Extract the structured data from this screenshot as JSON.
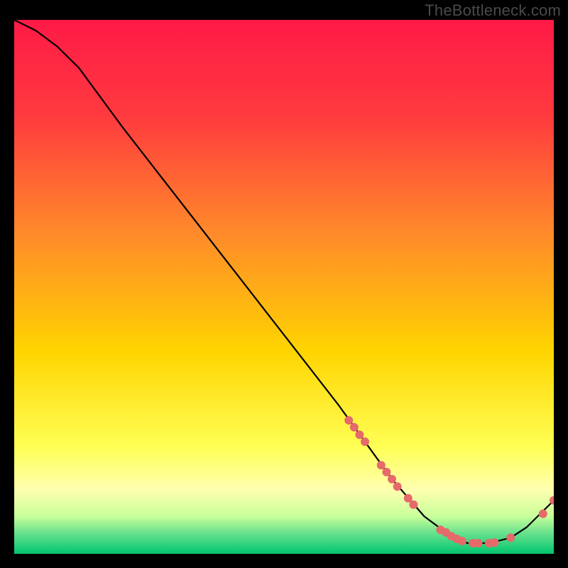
{
  "watermark": "TheBottleneck.com",
  "chart_data": {
    "type": "line",
    "title": "",
    "xlabel": "",
    "ylabel": "",
    "xlim": [
      0,
      100
    ],
    "ylim": [
      0,
      100
    ],
    "grid": false,
    "legend": false,
    "background_gradient_top": "#ff1a47",
    "background_gradient_mid": "#ffd500",
    "background_gradient_band": "#ffff7a",
    "background_gradient_bottom": "#00c56f",
    "series": [
      {
        "name": "curve",
        "x": [
          0,
          4,
          8,
          12,
          20,
          30,
          40,
          50,
          60,
          65,
          70,
          76,
          80,
          84,
          88,
          92,
          95,
          100
        ],
        "y": [
          100,
          98,
          95,
          91,
          80,
          67,
          54,
          41,
          28,
          21,
          14,
          7,
          4,
          2,
          2,
          3,
          5,
          10
        ]
      }
    ],
    "markers": {
      "name": "highlight-points",
      "color": "#e66a6a",
      "radius": 6,
      "points": [
        {
          "x": 62,
          "y": 25.0
        },
        {
          "x": 63,
          "y": 23.7
        },
        {
          "x": 64,
          "y": 22.3
        },
        {
          "x": 65,
          "y": 21.0
        },
        {
          "x": 68,
          "y": 16.6
        },
        {
          "x": 69,
          "y": 15.3
        },
        {
          "x": 70,
          "y": 14.0
        },
        {
          "x": 71,
          "y": 12.6
        },
        {
          "x": 73,
          "y": 10.4
        },
        {
          "x": 74,
          "y": 9.2
        },
        {
          "x": 79,
          "y": 4.5
        },
        {
          "x": 80,
          "y": 4.0
        },
        {
          "x": 81,
          "y": 3.3
        },
        {
          "x": 82,
          "y": 2.8
        },
        {
          "x": 83,
          "y": 2.4
        },
        {
          "x": 85,
          "y": 2.0
        },
        {
          "x": 86,
          "y": 2.0
        },
        {
          "x": 88,
          "y": 2.0
        },
        {
          "x": 89,
          "y": 2.1
        },
        {
          "x": 92,
          "y": 3.0
        },
        {
          "x": 98,
          "y": 7.5
        },
        {
          "x": 100,
          "y": 10.0
        }
      ]
    }
  }
}
